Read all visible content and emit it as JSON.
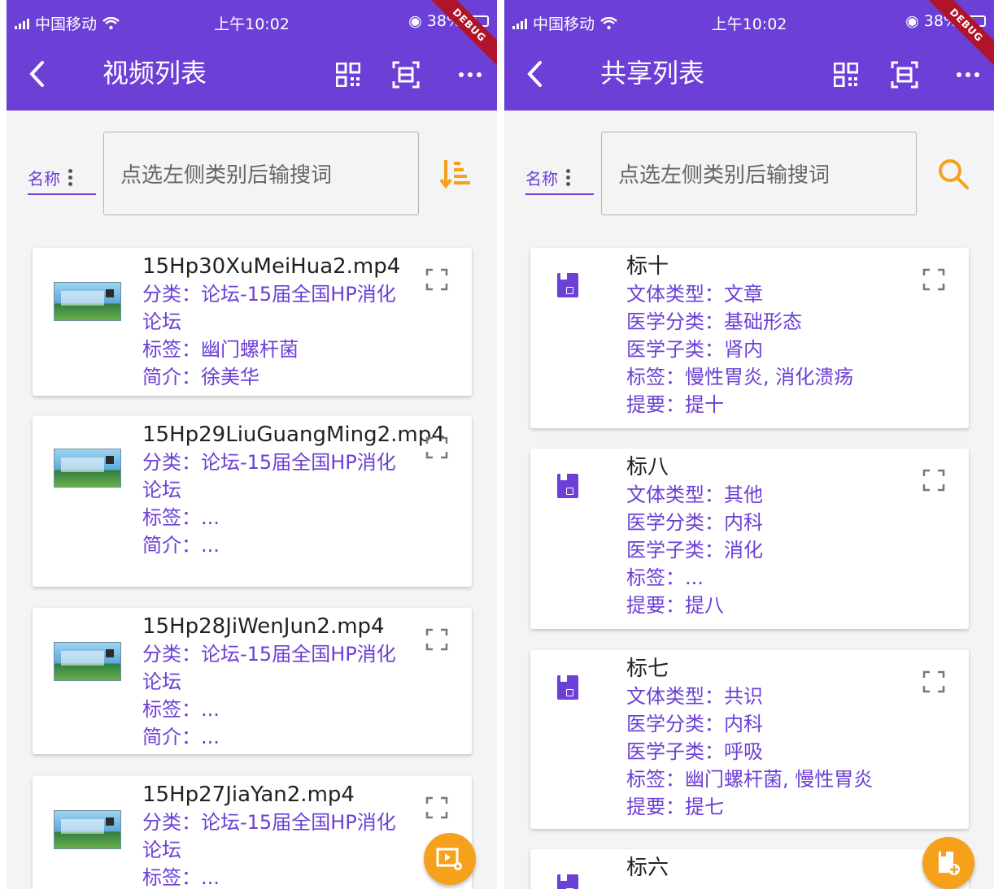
{
  "colors": {
    "primary": "#6c3fd6",
    "accent": "#f5a11b",
    "debug": "#b0142b"
  },
  "left": {
    "status": {
      "carrier": "中国移动",
      "time": "上午10:02",
      "battery": "38%",
      "debug": "DEBUG"
    },
    "appbar": {
      "title": "视频列表"
    },
    "filter_label": "名称",
    "search_placeholder": "点选左侧类别后输搜词",
    "items": [
      {
        "title": "15Hp30XuMeiHua2.mp4",
        "category": "分类：论坛-15届全国HP消化论坛",
        "tags": "标签：幽门螺杆菌",
        "intro": "简介：徐美华"
      },
      {
        "title": "15Hp29LiuGuangMing2.mp4",
        "category": "分类：论坛-15届全国HP消化论坛",
        "tags": "标签：...",
        "intro": "简介：..."
      },
      {
        "title": "15Hp28JiWenJun2.mp4",
        "category": "分类：论坛-15届全国HP消化论坛",
        "tags": "标签：...",
        "intro": "简介：..."
      },
      {
        "title": "15Hp27JiaYan2.mp4",
        "category": "分类：论坛-15届全国HP消化论坛",
        "tags": "标签：..."
      }
    ]
  },
  "right": {
    "status": {
      "carrier": "中国移动",
      "time": "上午10:02",
      "battery": "38%",
      "debug": "DEBUG"
    },
    "appbar": {
      "title": "共享列表"
    },
    "filter_label": "名称",
    "search_placeholder": "点选左侧类别后输搜词",
    "items": [
      {
        "title": "标十",
        "type": "文体类型：文章",
        "med_cat": "医学分类：基础形态",
        "med_sub": "医学子类：肾内",
        "tags": "标签：慢性胃炎, 消化溃疡",
        "summary": "提要：提十"
      },
      {
        "title": "标八",
        "type": "文体类型：其他",
        "med_cat": "医学分类：内科",
        "med_sub": "医学子类：消化",
        "tags": "标签：...",
        "summary": "提要：提八"
      },
      {
        "title": "标七",
        "type": "文体类型：共识",
        "med_cat": "医学分类：内科",
        "med_sub": "医学子类：呼吸",
        "tags": "标签：幽门螺杆菌, 慢性胃炎",
        "summary": "提要：提七"
      },
      {
        "title": "标六"
      }
    ]
  }
}
